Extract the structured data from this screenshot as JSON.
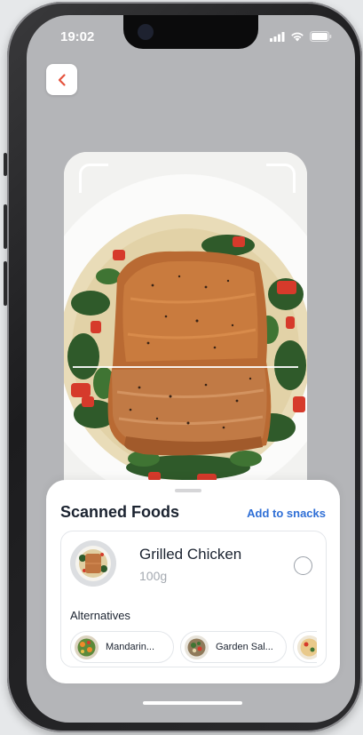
{
  "status_bar": {
    "time": "19:02",
    "signal_icon": "cellular-signal-icon",
    "wifi_icon": "wifi-icon",
    "battery_icon": "battery-icon"
  },
  "nav": {
    "back_icon": "chevron-left-icon",
    "accent_color": "#e5533d"
  },
  "scan": {
    "subject": "food-photo"
  },
  "sheet": {
    "title": "Scanned Foods",
    "action_label": "Add to snacks",
    "action_color": "#2f6fd6",
    "food": {
      "name": "Grilled Chicken",
      "weight": "100g",
      "selected": false
    },
    "alternatives_label": "Alternatives",
    "alternatives": [
      {
        "label": "Mandarin..."
      },
      {
        "label": "Garden Sal..."
      },
      {
        "label": ""
      }
    ]
  }
}
